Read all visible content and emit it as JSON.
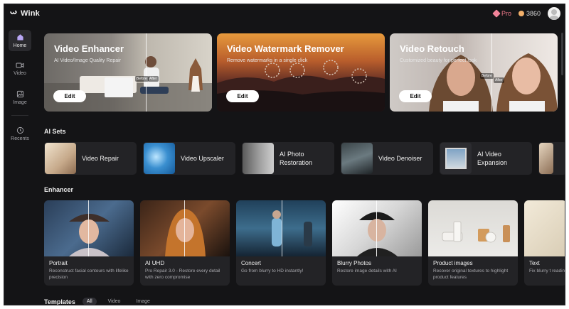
{
  "app": {
    "name": "Wink"
  },
  "header": {
    "pro_label": "Pro",
    "coins": "3860"
  },
  "sidebar": {
    "items": [
      {
        "label": "Home"
      },
      {
        "label": "Video"
      },
      {
        "label": "Image"
      },
      {
        "label": "Recents"
      }
    ]
  },
  "hero": [
    {
      "title": "Video Enhancer",
      "subtitle": "AI Video/Image Quality Repair",
      "button": "Edit",
      "tags": [
        "Before",
        "After"
      ]
    },
    {
      "title": "Video Watermark Remover",
      "subtitle": "Remove watermarks in a single click",
      "button": "Edit"
    },
    {
      "title": "Video Retouch",
      "subtitle": "Customized beauty for perfect look",
      "button": "Edit",
      "tags": [
        "Before",
        "After"
      ]
    }
  ],
  "ai_sets": {
    "title": "AI Sets",
    "items": [
      {
        "label": "Video Repair"
      },
      {
        "label": "Video Upscaler"
      },
      {
        "label": "AI Photo Restoration"
      },
      {
        "label": "Video Denoiser"
      },
      {
        "label": "AI Video Expansion"
      }
    ]
  },
  "enhancer": {
    "title": "Enhancer",
    "items": [
      {
        "title": "Portrait",
        "desc": "Reconstruct facial contours with lifelike precision"
      },
      {
        "title": "AI UHD",
        "desc": "Pro Repair 3.0 - Restore every detail with zero compromise"
      },
      {
        "title": "Concert",
        "desc": "Go from blurry to HD instantly!"
      },
      {
        "title": "Blurry Photos",
        "desc": "Restore image details with AI"
      },
      {
        "title": "Product images",
        "desc": "Recover original textures to highlight product features"
      },
      {
        "title": "Text",
        "desc": "Fix blurry t reading"
      }
    ]
  },
  "templates": {
    "title": "Templates",
    "tabs": [
      "All",
      "Video",
      "Image"
    ]
  },
  "colors": {
    "background": "#141416",
    "card": "#232326",
    "accent_pro": "#f07a8a",
    "coin": "#f3b06a"
  }
}
